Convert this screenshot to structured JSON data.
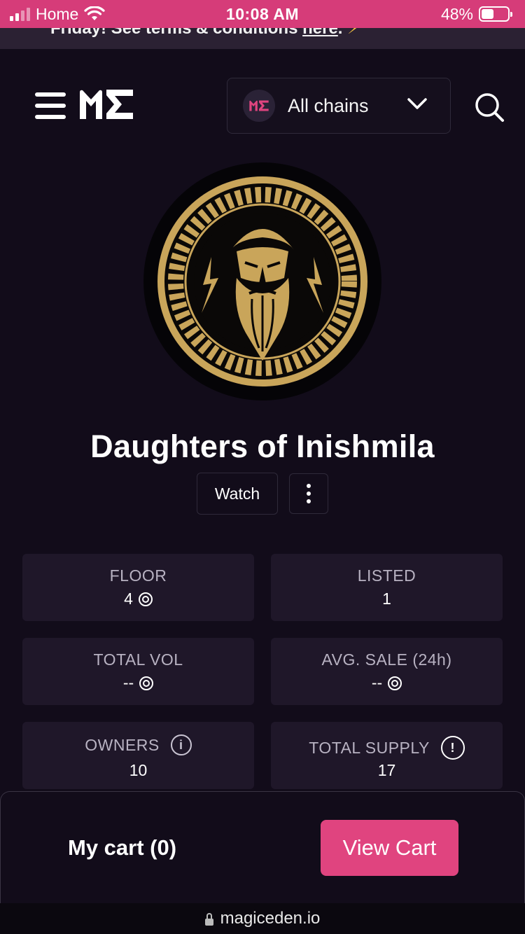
{
  "status_bar": {
    "carrier": "Home",
    "time": "10:08 AM",
    "battery_percent": "48%",
    "battery_level": 0.48
  },
  "promo": {
    "text": "Friday! See terms & conditions",
    "link": "here",
    "suffix": "."
  },
  "header": {
    "logo_icon": "magic-eden-logo",
    "chain_selector": {
      "label": "All chains",
      "icon": "magic-eden-logo"
    },
    "menu_icon": "hamburger-icon",
    "search_icon": "search-icon"
  },
  "collection": {
    "name": "Daughters of Inishmila",
    "avatar_icon": "zeus-medallion",
    "watch_label": "Watch",
    "more_icon": "more-vertical-icon"
  },
  "stats": [
    {
      "label": "FLOOR",
      "value": "4",
      "currency_icon": true
    },
    {
      "label": "LISTED",
      "value": "1",
      "currency_icon": false
    },
    {
      "label": "TOTAL VOL",
      "value": "--",
      "currency_icon": true
    },
    {
      "label": "AVG. SALE (24h)",
      "value": "--",
      "currency_icon": true
    },
    {
      "label": "OWNERS",
      "value": "10",
      "info_icon": "i"
    },
    {
      "label": "TOTAL SUPPLY",
      "value": "17",
      "info_icon": "!"
    }
  ],
  "cart": {
    "label": "My cart (0)",
    "button": "View Cart"
  },
  "browser": {
    "url": "magiceden.io"
  },
  "colors": {
    "background": "#120c1a",
    "status_bar": "#d63c79",
    "accent": "#e0447f",
    "card": "#1f1729",
    "gold": "#c9a55a"
  }
}
